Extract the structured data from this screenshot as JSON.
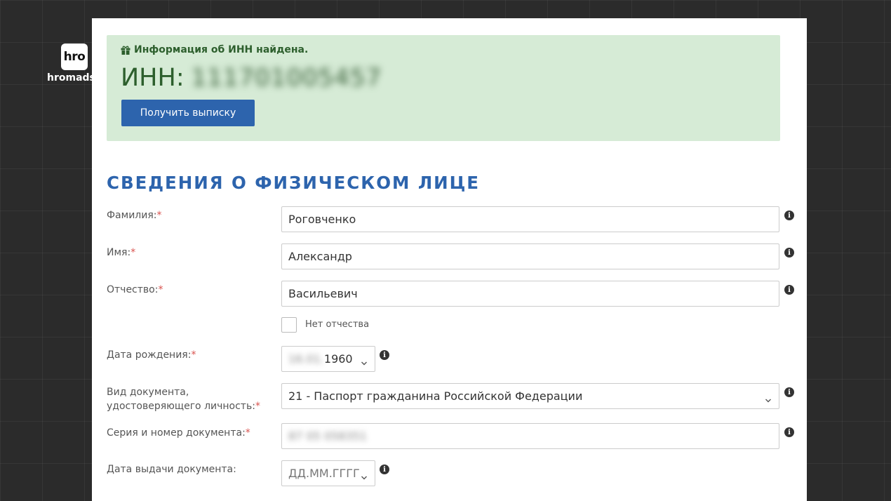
{
  "watermark": {
    "logo_text": "hro",
    "caption": "hromadske"
  },
  "alert": {
    "icon": "gift-icon",
    "title": "Информация об ИНН найдена.",
    "inn_label": "ИНН:",
    "inn_value": "111701005457",
    "button_label": "Получить выписку"
  },
  "section": {
    "title": "СВЕДЕНИЯ О ФИЗИЧЕСКОМ ЛИЦЕ"
  },
  "form": {
    "surname_label": "Фамилия:",
    "surname_value": "Роговченко",
    "name_label": "Имя:",
    "name_value": "Александр",
    "patronymic_label": "Отчество:",
    "patronymic_value": "Васильевич",
    "no_patronymic_label": "Нет отчества",
    "birthdate_label": "Дата рождения:",
    "birthdate_hidden": "16.01.",
    "birthdate_year": "1960",
    "doc_type_label_line1": "Вид документа,",
    "doc_type_label_line2": "удостоверяющего личность:",
    "doc_type_value": "21 - Паспорт гражданина Российской Федерации",
    "doc_number_label": "Серия и номер документа:",
    "doc_number_value": "87 05 058351",
    "issue_date_label": "Дата выдачи документа:",
    "issue_date_placeholder": "ДД.ММ.ГГГГ",
    "required_mark": "*",
    "info_glyph": "i"
  },
  "colors": {
    "accent": "#2d64ad",
    "alert_bg": "#d6ebd6",
    "alert_text": "#2d5f2d",
    "required": "#d9534f"
  }
}
